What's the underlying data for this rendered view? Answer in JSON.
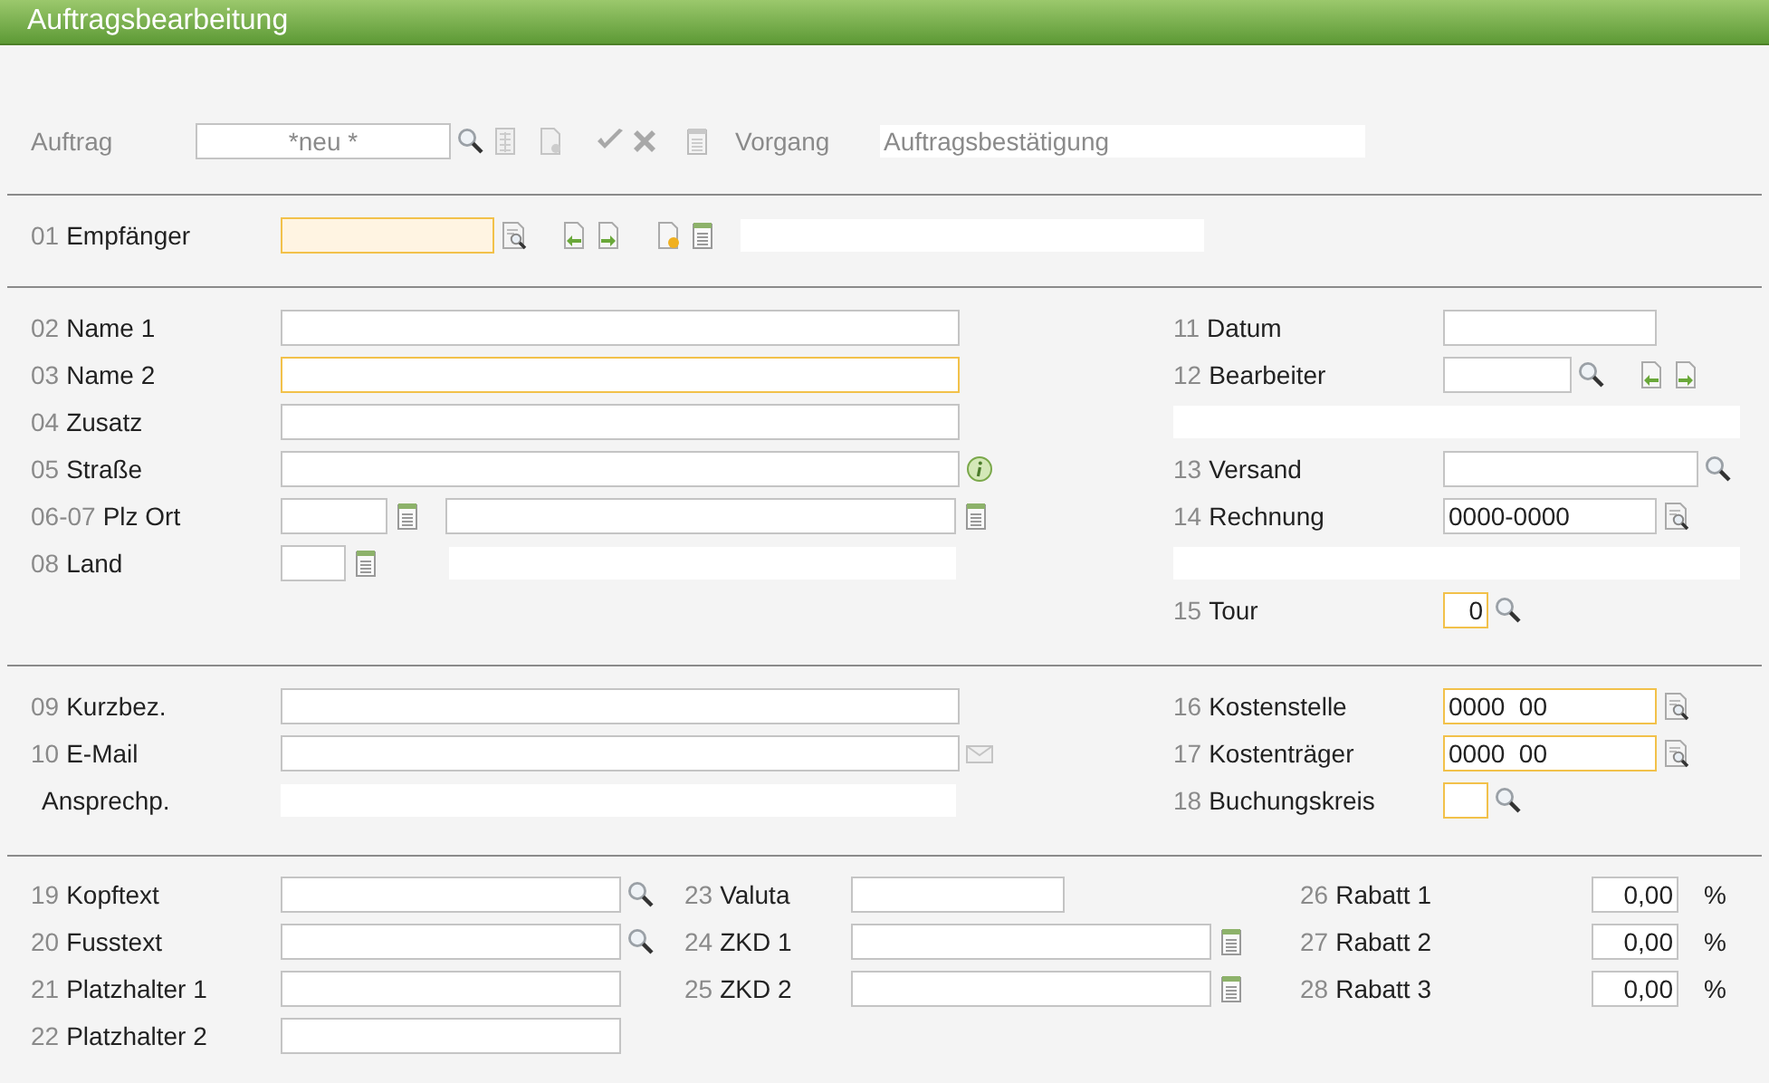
{
  "window": {
    "title": "Auftragsbearbeitung"
  },
  "order_bar": {
    "order_label": "Auftrag",
    "order_value": "*neu *",
    "process_label": "Vorgang",
    "process_value": "Auftragsbestätigung"
  },
  "recipient": {
    "number": "01",
    "label": "Empfänger",
    "highlighted": true,
    "focused": true
  },
  "address_fields": [
    {
      "number": "02",
      "label": "Name 1",
      "highlighted": false
    },
    {
      "number": "03",
      "label": "Name 2",
      "highlighted": true
    },
    {
      "number": "04",
      "label": "Zusatz",
      "highlighted": false
    },
    {
      "number": "05",
      "label": "Straße",
      "highlighted": false
    },
    {
      "number": "06-07",
      "label": "Plz Ort",
      "highlighted": false
    },
    {
      "number": "08",
      "label": "Land",
      "highlighted": false
    }
  ],
  "order_fields": [
    {
      "number": "11",
      "label": "Datum",
      "highlighted": false
    },
    {
      "number": "12",
      "label": "Bearbeiter",
      "highlighted": false
    },
    {
      "number": "13",
      "label": "Versand",
      "highlighted": false
    },
    {
      "number": "14",
      "label": "Rechnung",
      "value": "0000-0000",
      "highlighted": false
    },
    {
      "number": "15",
      "label": "Tour",
      "value": "0",
      "highlighted": true
    }
  ],
  "contact_fields": [
    {
      "number": "09",
      "label": "Kurzbez.",
      "highlighted": false
    },
    {
      "number": "10",
      "label": "E-Mail",
      "highlighted": false
    },
    {
      "label": "Ansprechp.",
      "highlighted": false
    }
  ],
  "cost_fields": [
    {
      "number": "16",
      "label": "Kostenstelle",
      "value": "0000  00",
      "highlighted": true
    },
    {
      "number": "17",
      "label": "Kostenträger",
      "value": "0000  00",
      "highlighted": true
    },
    {
      "number": "18",
      "label": "Buchungskreis",
      "highlighted": true
    }
  ],
  "text_fields": [
    {
      "number": "19",
      "label": "Kopftext",
      "highlighted": false
    },
    {
      "number": "20",
      "label": "Fusstext",
      "highlighted": false
    },
    {
      "number": "21",
      "label": "Platzhalter 1",
      "highlighted": false
    },
    {
      "number": "22",
      "label": "Platzhalter 2",
      "highlighted": false
    }
  ],
  "extra_fields": [
    {
      "number": "23",
      "label": "Valuta",
      "highlighted": false
    },
    {
      "number": "24",
      "label": "ZKD 1",
      "highlighted": false
    },
    {
      "number": "25",
      "label": "ZKD 2",
      "highlighted": false
    }
  ],
  "discounts": [
    {
      "number": "26",
      "label": "Rabatt 1",
      "value": "0,00",
      "unit": "%",
      "highlighted": false
    },
    {
      "number": "27",
      "label": "Rabatt 2",
      "value": "0,00",
      "unit": "%",
      "highlighted": false
    },
    {
      "number": "28",
      "label": "Rabatt 3",
      "value": "0,00",
      "unit": "%",
      "highlighted": false
    }
  ]
}
